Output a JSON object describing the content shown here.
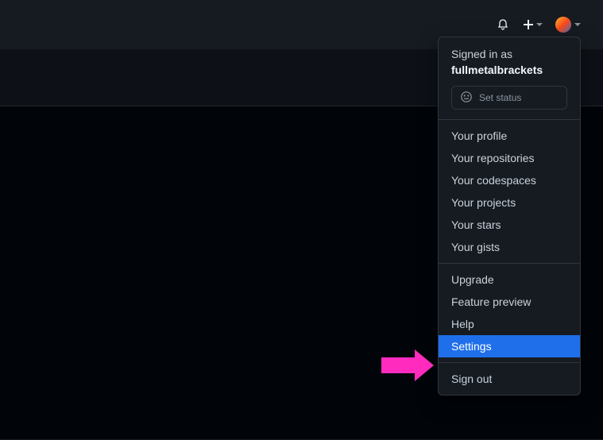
{
  "signed_in_label": "Signed in as",
  "username": "fullmetalbrackets",
  "set_status_label": "Set status",
  "menu": {
    "section1": [
      "Your profile",
      "Your repositories",
      "Your codespaces",
      "Your projects",
      "Your stars",
      "Your gists"
    ],
    "section2": [
      "Upgrade",
      "Feature preview",
      "Help",
      "Settings"
    ],
    "section3": [
      "Sign out"
    ]
  },
  "highlighted_item": "Settings"
}
